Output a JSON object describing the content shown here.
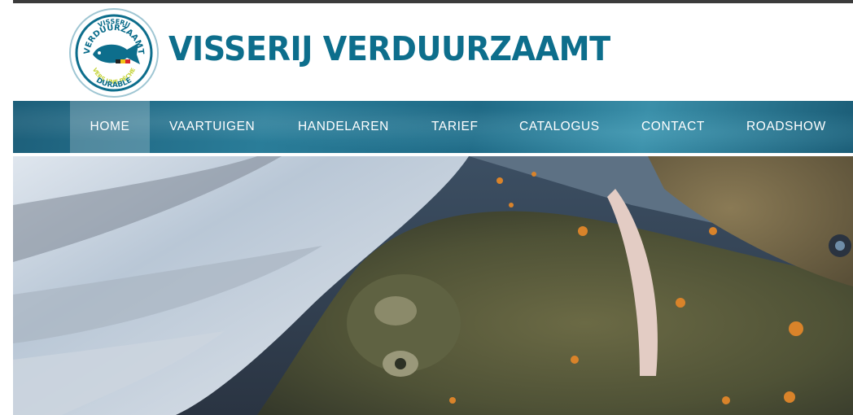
{
  "header": {
    "title": "VISSERIJ VERDUURZAAMT",
    "logo": {
      "top_text": "VISSERIJ",
      "main_text": "VERDUURZAAMT",
      "sub_text": "VERS UNE PÊCHE",
      "bottom_text": "DURABLE"
    }
  },
  "nav": {
    "items": [
      {
        "label": "HOME",
        "active": true
      },
      {
        "label": "VAARTUIGEN",
        "active": false
      },
      {
        "label": "HANDELAREN",
        "active": false
      },
      {
        "label": "TARIEF",
        "active": false
      },
      {
        "label": "CATALOGUS",
        "active": false
      },
      {
        "label": "CONTACT",
        "active": false
      },
      {
        "label": "ROADSHOW",
        "active": false
      }
    ]
  },
  "colors": {
    "brand": "#0d6e8c",
    "nav_background": "#2a7d99",
    "nav_text": "#ffffff"
  }
}
